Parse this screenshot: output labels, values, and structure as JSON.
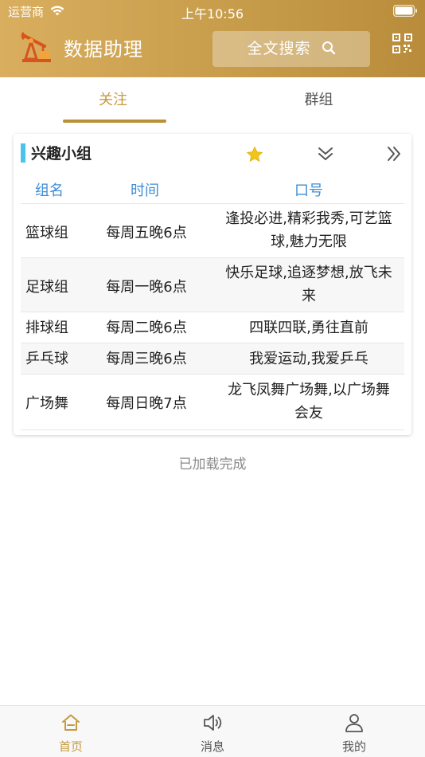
{
  "status_bar": {
    "carrier": "运营商",
    "time": "上午10:56"
  },
  "app_bar": {
    "title": "数据助理",
    "search_label": "全文搜索"
  },
  "tabs": [
    {
      "label": "关注",
      "active": true
    },
    {
      "label": "群组",
      "active": false
    }
  ],
  "card": {
    "title": "兴趣小组",
    "columns": [
      "组名",
      "时间",
      "口号"
    ],
    "rows": [
      {
        "name": "篮球组",
        "time": "每周五晚6点",
        "slogan_line1": "逢投必进,精彩我秀,可艺篮",
        "slogan_line2": "球,魅力无限"
      },
      {
        "name": "足球组",
        "time": "每周一晚6点",
        "slogan_line1": "快乐足球,追逐梦想,放飞未",
        "slogan_line2": "来"
      },
      {
        "name": "排球组",
        "time": "每周二晚6点",
        "slogan_line1": "四联四联,勇往直前",
        "slogan_line2": ""
      },
      {
        "name": "乒乓球",
        "time": "每周三晚6点",
        "slogan_line1": "我爱运动,我爱乒乓",
        "slogan_line2": ""
      },
      {
        "name": "广场舞",
        "time": "每周日晚7点",
        "slogan_line1": "龙飞凤舞广场舞,以广场舞",
        "slogan_line2": "会友"
      }
    ]
  },
  "footer_status": "已加载完成",
  "bottom_nav": [
    {
      "label": "首页",
      "icon": "home-icon",
      "active": true
    },
    {
      "label": "消息",
      "icon": "speaker-icon",
      "active": false
    },
    {
      "label": "我的",
      "icon": "user-icon",
      "active": false
    }
  ],
  "colors": {
    "header_gradient_start": "#d9ae5e",
    "header_gradient_end": "#b88c3a",
    "accent": "#c59a3e",
    "table_header": "#3d8ed6",
    "card_bar": "#4cc3ee",
    "star": "#f0c419"
  }
}
